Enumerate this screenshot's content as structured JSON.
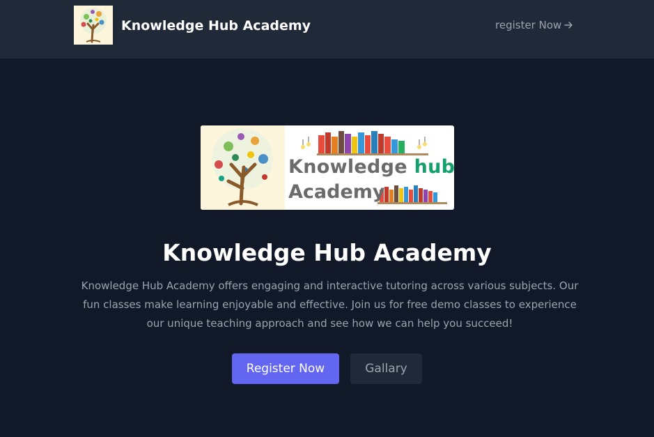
{
  "header": {
    "brand_title": "Knowledge Hub Academy",
    "register_link": "register Now",
    "register_link_icon": "arrow-right-icon"
  },
  "banner": {
    "line1_part1": "Knowledge",
    "line1_part2": "hub",
    "line2": "Academy"
  },
  "hero": {
    "title": "Knowledge Hub Academy",
    "description": "Knowledge Hub Academy offers engaging and interactive tutoring across various subjects. Our fun classes make learning enjoyable and effective. Join us for free demo classes to experience our unique teaching approach and see how we can help you succeed!",
    "primary_button": "Register Now",
    "secondary_button": "Gallary"
  },
  "colors": {
    "page_background": "#111827",
    "header_background": "#1f2937",
    "primary_accent": "#6366f1",
    "muted_text": "#9ca3af",
    "banner_hub_green": "#14a06b"
  }
}
